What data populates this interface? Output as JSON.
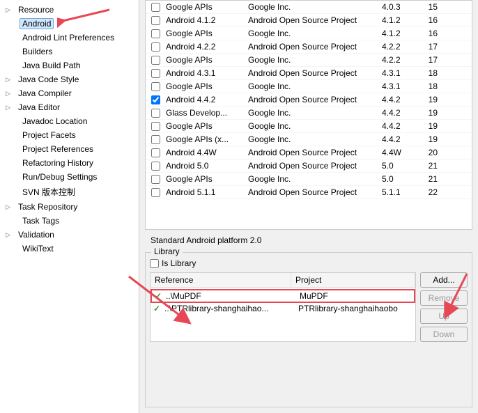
{
  "tree": {
    "resource": "Resource",
    "android": "Android",
    "android_lint": "Android Lint Preferences",
    "builders": "Builders",
    "java_build_path": "Java Build Path",
    "java_code_style": "Java Code Style",
    "java_compiler": "Java Compiler",
    "java_editor": "Java Editor",
    "javadoc_location": "Javadoc Location",
    "project_facets": "Project Facets",
    "project_references": "Project References",
    "refactoring_history": "Refactoring History",
    "run_debug_settings": "Run/Debug Settings",
    "svn": "SVN 版本控制",
    "task_repository": "Task Repository",
    "task_tags": "Task Tags",
    "validation": "Validation",
    "wikitext": "WikiText"
  },
  "targets": [
    {
      "checked": false,
      "name": "Google APIs",
      "vendor": "Google Inc.",
      "ver": "4.0.3",
      "api": "15"
    },
    {
      "checked": false,
      "name": "Android 4.1.2",
      "vendor": "Android Open Source Project",
      "ver": "4.1.2",
      "api": "16"
    },
    {
      "checked": false,
      "name": "Google APIs",
      "vendor": "Google Inc.",
      "ver": "4.1.2",
      "api": "16"
    },
    {
      "checked": false,
      "name": "Android 4.2.2",
      "vendor": "Android Open Source Project",
      "ver": "4.2.2",
      "api": "17"
    },
    {
      "checked": false,
      "name": "Google APIs",
      "vendor": "Google Inc.",
      "ver": "4.2.2",
      "api": "17"
    },
    {
      "checked": false,
      "name": "Android 4.3.1",
      "vendor": "Android Open Source Project",
      "ver": "4.3.1",
      "api": "18"
    },
    {
      "checked": false,
      "name": "Google APIs",
      "vendor": "Google Inc.",
      "ver": "4.3.1",
      "api": "18"
    },
    {
      "checked": true,
      "name": "Android 4.4.2",
      "vendor": "Android Open Source Project",
      "ver": "4.4.2",
      "api": "19"
    },
    {
      "checked": false,
      "name": "Glass Develop...",
      "vendor": "Google Inc.",
      "ver": "4.4.2",
      "api": "19"
    },
    {
      "checked": false,
      "name": "Google APIs",
      "vendor": "Google Inc.",
      "ver": "4.4.2",
      "api": "19"
    },
    {
      "checked": false,
      "name": "Google APIs (x...",
      "vendor": "Google Inc.",
      "ver": "4.4.2",
      "api": "19"
    },
    {
      "checked": false,
      "name": "Android 4.4W",
      "vendor": "Android Open Source Project",
      "ver": "4.4W",
      "api": "20"
    },
    {
      "checked": false,
      "name": "Android 5.0",
      "vendor": "Android Open Source Project",
      "ver": "5.0",
      "api": "21"
    },
    {
      "checked": false,
      "name": "Google APIs",
      "vendor": "Google Inc.",
      "ver": "5.0",
      "api": "21"
    },
    {
      "checked": false,
      "name": "Android 5.1.1",
      "vendor": "Android Open Source Project",
      "ver": "5.1.1",
      "api": "22"
    }
  ],
  "platform_label": "Standard Android platform 2.0",
  "library": {
    "legend": "Library",
    "is_library_label": "Is Library",
    "header_ref": "Reference",
    "header_proj": "Project",
    "rows": [
      {
        "ref": "..\\MuPDF",
        "proj": "MuPDF",
        "highlight": true
      },
      {
        "ref": "..\\PTRlibrary-shanghaihao...",
        "proj": "PTRlibrary-shanghaihaobo",
        "highlight": false
      }
    ],
    "btn_add": "Add...",
    "btn_remove": "Remove",
    "btn_up": "Up",
    "btn_down": "Down"
  }
}
